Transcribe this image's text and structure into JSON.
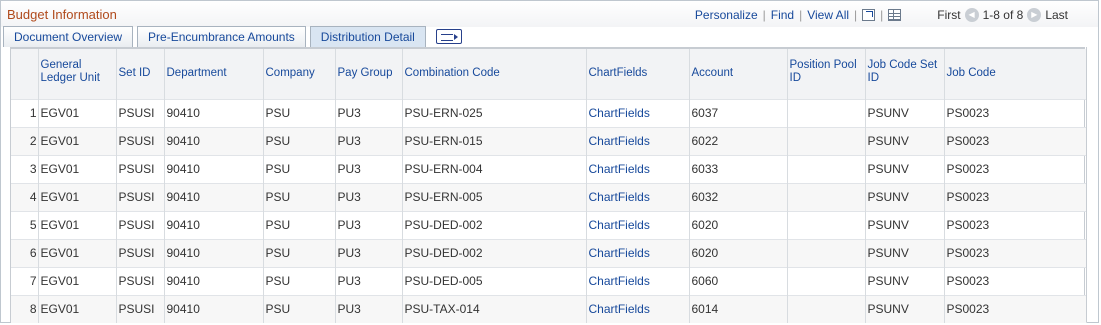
{
  "grid": {
    "title": "Budget Information",
    "nav": {
      "personalize": "Personalize",
      "find": "Find",
      "view_all": "View All",
      "first": "First",
      "range": "1-8 of 8",
      "last": "Last"
    }
  },
  "tabs": [
    {
      "label": "Document Overview",
      "active": false
    },
    {
      "label": "Pre-Encumbrance Amounts",
      "active": false
    },
    {
      "label": "Distribution Detail",
      "active": true
    }
  ],
  "columns": {
    "gl_unit": "General Ledger Unit",
    "set_id": "Set ID",
    "department": "Department",
    "company": "Company",
    "pay_group": "Pay Group",
    "combination_code": "Combination Code",
    "chartfields": "ChartFields",
    "account": "Account",
    "position_pool_id": "Position Pool ID",
    "job_code_set_id": "Job Code Set ID",
    "job_code": "Job Code"
  },
  "rows": [
    {
      "n": "1",
      "gl_unit": "EGV01",
      "set_id": "PSUSI",
      "department": "90410",
      "company": "PSU",
      "pay_group": "PU3",
      "combination_code": "PSU-ERN-025",
      "chartfields": "ChartFields",
      "account": "6037",
      "position_pool_id": "",
      "job_code_set_id": "PSUNV",
      "job_code": "PS0023"
    },
    {
      "n": "2",
      "gl_unit": "EGV01",
      "set_id": "PSUSI",
      "department": "90410",
      "company": "PSU",
      "pay_group": "PU3",
      "combination_code": "PSU-ERN-015",
      "chartfields": "ChartFields",
      "account": "6022",
      "position_pool_id": "",
      "job_code_set_id": "PSUNV",
      "job_code": "PS0023"
    },
    {
      "n": "3",
      "gl_unit": "EGV01",
      "set_id": "PSUSI",
      "department": "90410",
      "company": "PSU",
      "pay_group": "PU3",
      "combination_code": "PSU-ERN-004",
      "chartfields": "ChartFields",
      "account": "6033",
      "position_pool_id": "",
      "job_code_set_id": "PSUNV",
      "job_code": "PS0023"
    },
    {
      "n": "4",
      "gl_unit": "EGV01",
      "set_id": "PSUSI",
      "department": "90410",
      "company": "PSU",
      "pay_group": "PU3",
      "combination_code": "PSU-ERN-005",
      "chartfields": "ChartFields",
      "account": "6032",
      "position_pool_id": "",
      "job_code_set_id": "PSUNV",
      "job_code": "PS0023"
    },
    {
      "n": "5",
      "gl_unit": "EGV01",
      "set_id": "PSUSI",
      "department": "90410",
      "company": "PSU",
      "pay_group": "PU3",
      "combination_code": "PSU-DED-002",
      "chartfields": "ChartFields",
      "account": "6020",
      "position_pool_id": "",
      "job_code_set_id": "PSUNV",
      "job_code": "PS0023"
    },
    {
      "n": "6",
      "gl_unit": "EGV01",
      "set_id": "PSUSI",
      "department": "90410",
      "company": "PSU",
      "pay_group": "PU3",
      "combination_code": "PSU-DED-002",
      "chartfields": "ChartFields",
      "account": "6020",
      "position_pool_id": "",
      "job_code_set_id": "PSUNV",
      "job_code": "PS0023"
    },
    {
      "n": "7",
      "gl_unit": "EGV01",
      "set_id": "PSUSI",
      "department": "90410",
      "company": "PSU",
      "pay_group": "PU3",
      "combination_code": "PSU-DED-005",
      "chartfields": "ChartFields",
      "account": "6060",
      "position_pool_id": "",
      "job_code_set_id": "PSUNV",
      "job_code": "PS0023"
    },
    {
      "n": "8",
      "gl_unit": "EGV01",
      "set_id": "PSUSI",
      "department": "90410",
      "company": "PSU",
      "pay_group": "PU3",
      "combination_code": "PSU-TAX-014",
      "chartfields": "ChartFields",
      "account": "6014",
      "position_pool_id": "",
      "job_code_set_id": "PSUNV",
      "job_code": "PS0023"
    }
  ],
  "icons": {
    "zoom": "zoom-grid-icon",
    "download": "download-to-excel-icon",
    "prev": "previous-row-icon",
    "next": "next-row-icon",
    "show_all_columns": "show-all-columns-icon"
  },
  "colors": {
    "title": "#b04a1c",
    "link": "#17499b",
    "active_tab": "#d9e5f2"
  }
}
